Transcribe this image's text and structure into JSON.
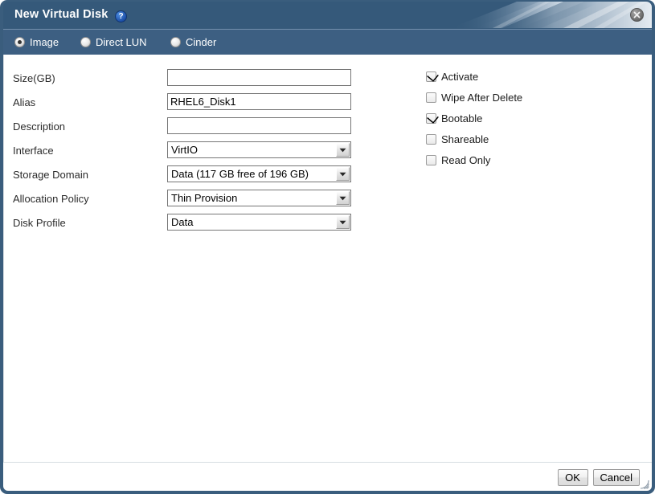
{
  "window": {
    "title": "New Virtual Disk",
    "help_icon": "question-mark-icon",
    "close_icon": "close-icon",
    "frame_color": "#3a5d7d",
    "titlebar_color": "#35597a",
    "tabbar_color": "#3d5f82"
  },
  "disk_type": {
    "selected": "Image",
    "options": [
      {
        "label": "Image",
        "checked": true
      },
      {
        "label": "Direct LUN",
        "checked": false
      },
      {
        "label": "Cinder",
        "checked": false
      }
    ]
  },
  "form": {
    "rows": [
      {
        "label": "Size(GB)",
        "control": "text",
        "value": "",
        "placeholder": "",
        "focused": true
      },
      {
        "label": "Alias",
        "control": "text",
        "value": "RHEL6_Disk1",
        "placeholder": "",
        "focused": false
      },
      {
        "label": "Description",
        "control": "text",
        "value": "",
        "placeholder": "",
        "focused": false
      },
      {
        "label": "Interface",
        "control": "select",
        "value": "VirtIO",
        "placeholder": "",
        "focused": false
      },
      {
        "label": "Storage Domain",
        "control": "select",
        "value": "Data (117 GB free of 196 GB)",
        "placeholder": "",
        "focused": false
      },
      {
        "label": "Allocation Policy",
        "control": "select",
        "value": "Thin Provision",
        "placeholder": "",
        "focused": false
      },
      {
        "label": "Disk Profile",
        "control": "select",
        "value": "Data",
        "placeholder": "",
        "focused": false
      }
    ]
  },
  "options": {
    "checkboxes": [
      {
        "label": "Activate",
        "checked": true
      },
      {
        "label": "Wipe After Delete",
        "checked": false
      },
      {
        "label": "Bootable",
        "checked": true
      },
      {
        "label": "Shareable",
        "checked": false
      },
      {
        "label": "Read Only",
        "checked": false
      }
    ]
  },
  "footer": {
    "ok_label": "OK",
    "cancel_label": "Cancel"
  }
}
